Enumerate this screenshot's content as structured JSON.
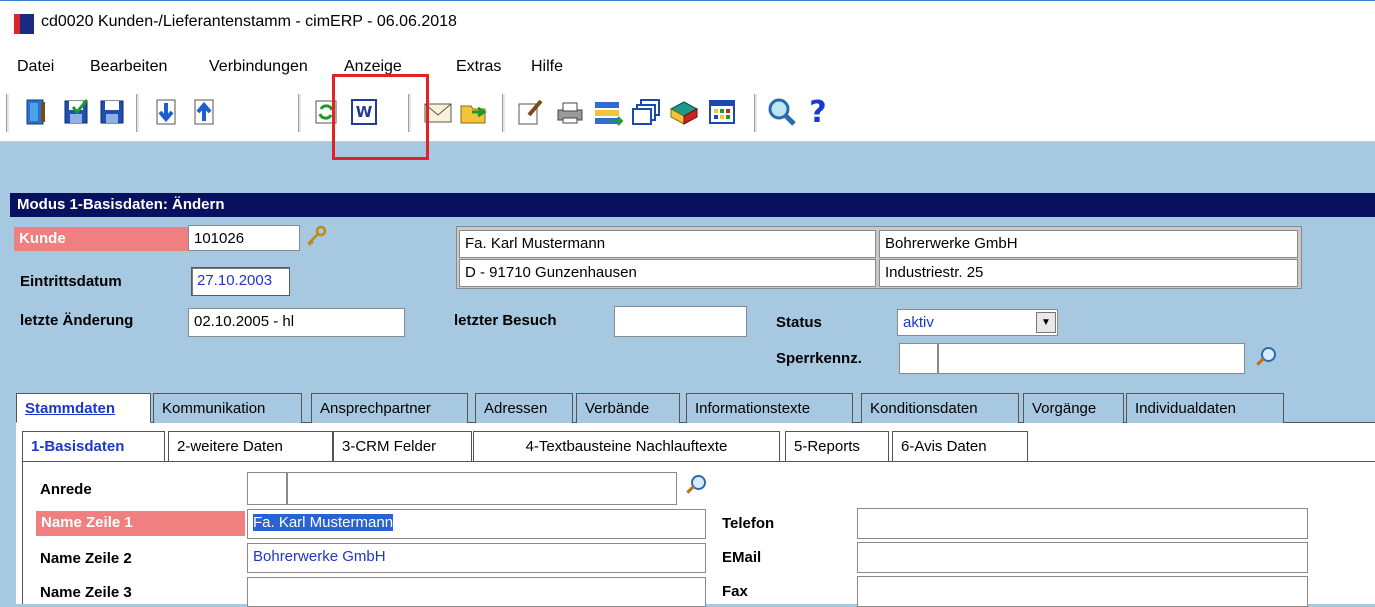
{
  "window": {
    "title": "cd0020 Kunden-/Lieferantenstamm - cimERP - 06.06.2018"
  },
  "menu": {
    "items": [
      "Datei",
      "Bearbeiten",
      "Verbindungen",
      "Anzeige",
      "Extras",
      "Hilfe"
    ]
  },
  "toolbar": {
    "buttons": [
      {
        "icon": "exit-door-icon"
      },
      {
        "icon": "save-check-icon"
      },
      {
        "icon": "save-icon"
      },
      {
        "icon": "arrow-down-icon"
      },
      {
        "icon": "arrow-up-icon"
      },
      {
        "icon": "refresh-icon"
      },
      {
        "icon": "word-document-icon",
        "glyph": "W"
      },
      {
        "icon": "envelope-icon"
      },
      {
        "icon": "folder-export-icon"
      },
      {
        "icon": "edit-document-icon"
      },
      {
        "icon": "printer-icon"
      },
      {
        "icon": "list-transfer-icon"
      },
      {
        "icon": "windows-icon"
      },
      {
        "icon": "book-icon"
      },
      {
        "icon": "grid-icon"
      },
      {
        "icon": "magnifier-icon"
      },
      {
        "icon": "help-icon",
        "glyph": "?"
      }
    ]
  },
  "mode_bar": {
    "text": "Modus 1-Basisdaten: Ändern"
  },
  "header": {
    "kunde_label": "Kunde",
    "kunde_value": "101026",
    "eintritt_label": "Eintrittsdatum",
    "eintritt_value": "27.10.2003",
    "letzte_label": "letzte Änderung",
    "letzte_value": "02.10.2005 - hl",
    "besuch_label": "letzter Besuch",
    "besuch_value": "",
    "status_label": "Status",
    "status_value": "aktiv",
    "sperr_label": "Sperrkennz.",
    "sperr_code": "",
    "sperr_text": ""
  },
  "address": {
    "name1": "Fa. Karl Mustermann",
    "name2": "Bohrerwerke GmbH",
    "city": "D - 91710 Gunzenhausen",
    "street": "Industriestr. 25"
  },
  "tabs": [
    "Stammdaten",
    "Kommunikation",
    "Ansprechpartner",
    "Adressen",
    "Verbände",
    "Informationstexte",
    "Konditionsdaten",
    "Vorgänge",
    "Individualdaten"
  ],
  "subtabs": [
    "1-Basisdaten",
    "2-weitere Daten",
    "3-CRM Felder",
    "4-Textbausteine Nachlauftexte",
    "5-Reports",
    "6-Avis Daten"
  ],
  "form": {
    "anrede_label": "Anrede",
    "anrede_code": "",
    "anrede_text": "",
    "name1_label": "Name Zeile 1",
    "name1_value": "Fa. Karl Mustermann",
    "name2_label": "Name Zeile 2",
    "name2_value": "Bohrerwerke GmbH",
    "name3_label": "Name Zeile 3",
    "name3_value": "",
    "telefon_label": "Telefon",
    "telefon_value": "",
    "email_label": "EMail",
    "email_value": "",
    "fax_label": "Fax",
    "fax_value": ""
  },
  "colors": {
    "panel_bg": "#a6c8e0",
    "mode_bar_bg": "#08115e",
    "required_label_bg": "#f08080",
    "highlight": "#e22323",
    "value_blue": "#1c37c9"
  }
}
